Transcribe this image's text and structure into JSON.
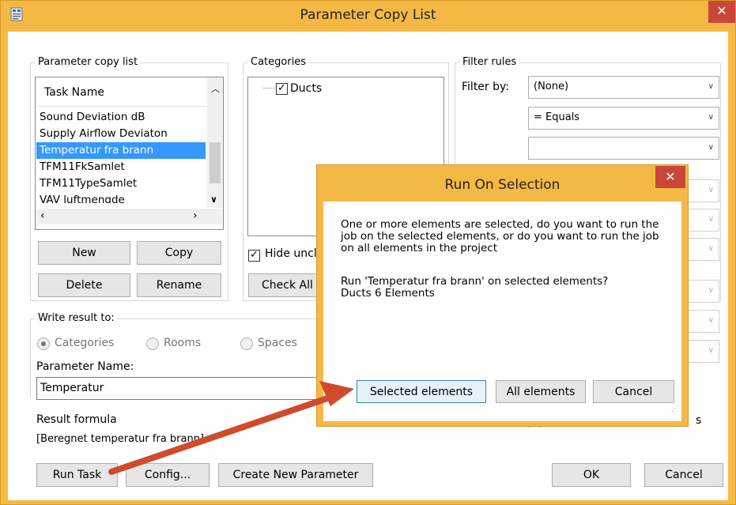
{
  "window": {
    "title": "Parameter Copy List",
    "close_glyph": "✕",
    "icon": "app-icon"
  },
  "param_list": {
    "legend": "Parameter copy list",
    "header": "Task Name",
    "items": [
      "Sound Deviation dB",
      "Supply Airflow Deviaton",
      "Temperatur fra brann",
      "TFM11FkSamlet",
      "TFM11TypeSamlet",
      "VAV luftmengde"
    ],
    "selected": "Temperatur fra brann"
  },
  "list_buttons": {
    "new": "New",
    "copy": "Copy",
    "delete": "Delete",
    "rename": "Rename"
  },
  "categories": {
    "legend": "Categories",
    "items": [
      {
        "label": "Ducts",
        "checked": true
      }
    ],
    "hide_label": "Hide uncl",
    "check_all": "Check All"
  },
  "filter": {
    "legend": "Filter rules",
    "filter_by_label": "Filter by:",
    "filter_by_value": "(None)",
    "operator_value": "= Equals",
    "value": ""
  },
  "write_result": {
    "legend": "Write result to:",
    "options": [
      "Categories",
      "Rooms",
      "Spaces"
    ],
    "selected": "Categories",
    "param_name_label": "Parameter Name:",
    "param_name_value": "Temperatur"
  },
  "result": {
    "label": "Result formula",
    "formula": "[Beregnet temperatur fra brann]"
  },
  "bottom_buttons": {
    "run_task": "Run Task",
    "config": "Config...",
    "create_param": "Create New Parameter",
    "ok": "OK",
    "cancel": "Cancel"
  },
  "popup": {
    "title": "Run On Selection",
    "close_glyph": "✕",
    "message_lines": [
      "One or more elements are selected, do you want to run the",
      "job on the selected elements, or do you want to run the job",
      "on all elements in the project"
    ],
    "question": "Run 'Temperatur fra brann' on selected elements?",
    "count": "Ducts 6 Elements",
    "buttons": {
      "selected": "Selected elements",
      "all": "All elements",
      "cancel": "Cancel"
    }
  },
  "colors": {
    "frame": "#f4b945",
    "close": "#c9473a",
    "selection": "#3399ff",
    "annotation_arrow": "#cf4b2b"
  }
}
